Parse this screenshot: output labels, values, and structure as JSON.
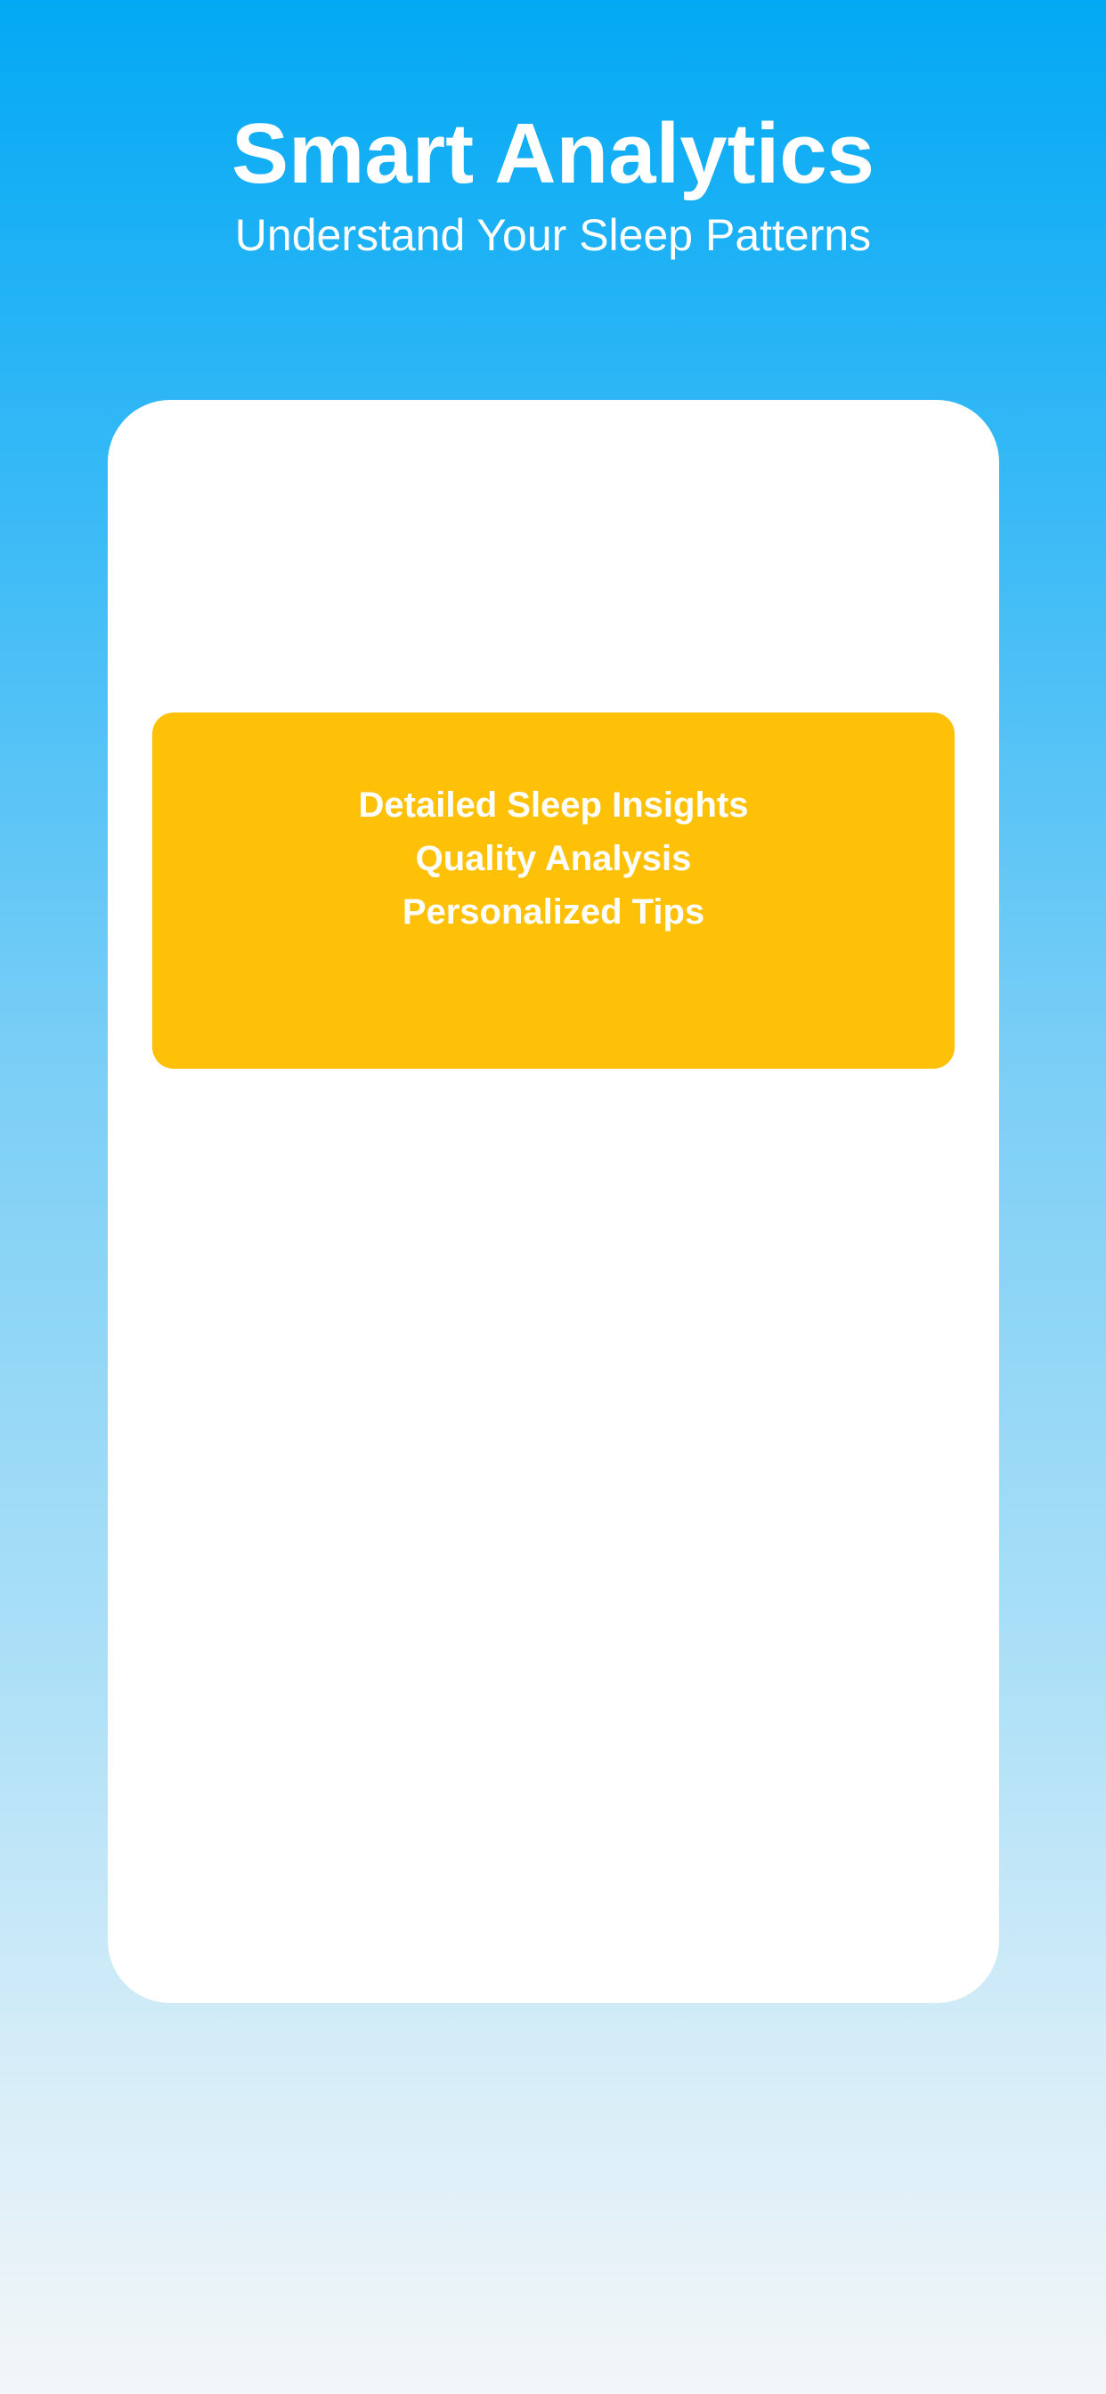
{
  "header": {
    "title": "Smart Analytics",
    "subtitle": "Understand Your Sleep Patterns"
  },
  "feature_box": {
    "items": [
      "Detailed Sleep Insights",
      "Quality Analysis",
      "Personalized Tips"
    ]
  },
  "colors": {
    "background_top": "#03A9F4",
    "background_bottom": "#F3F6F8",
    "card": "#FFFFFF",
    "accent": "#FFC107",
    "text_light": "#FFFFFF"
  }
}
